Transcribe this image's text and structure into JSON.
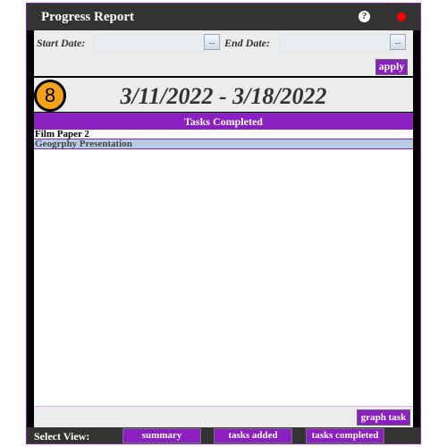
{
  "window": {
    "title": "Progress Report",
    "help_icon": "help-icon",
    "close_color": "#ff0000"
  },
  "filters": {
    "start_label": "Start Date:",
    "start_value": "",
    "end_label": "End Date:",
    "end_value": "",
    "picker_label": "...",
    "apply_label": "apply"
  },
  "range": {
    "badge": "8",
    "text": "3/11/2022 - 3/18/2022"
  },
  "list": {
    "header": "Tasks Completed",
    "items": [
      "Film Paper 2",
      "Geogrphy Presentation"
    ]
  },
  "graph_label": "graph task",
  "footer": {
    "label": "Select View:",
    "views": [
      "summary",
      "tasks added",
      "tasks completed"
    ]
  },
  "colors": {
    "accent": "#8b1fbf",
    "badge": "#f7a11a",
    "titlebar": "#333333"
  }
}
